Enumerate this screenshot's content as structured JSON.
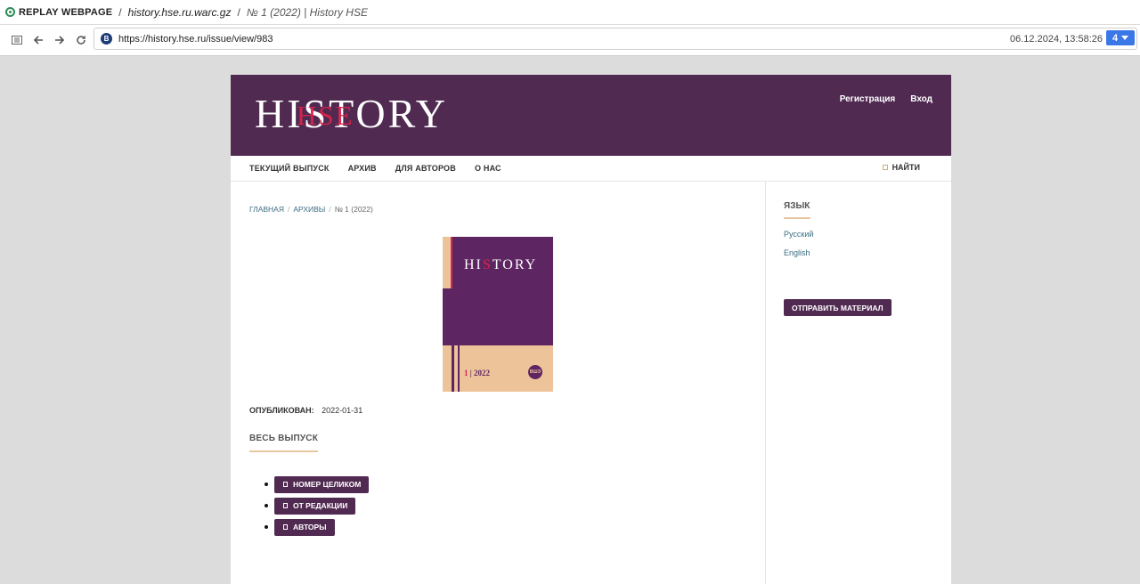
{
  "replay": {
    "brand": "REPLAY WEBPAGE",
    "archive": "history.hse.ru.warc.gz",
    "page_title": "№ 1 (2022) | History HSE"
  },
  "address_bar": {
    "url": "https://history.hse.ru/issue/view/983",
    "timestamp": "06.12.2024, 13:58:26",
    "capture_count": "4"
  },
  "header": {
    "logo_text": "HISTORY",
    "logo_overlay": "HSE",
    "user_nav": [
      "Регистрация",
      "Вход"
    ]
  },
  "main_nav": {
    "items": [
      "ТЕКУЩИЙ ВЫПУСК",
      "АРХИВ",
      "ДЛЯ АВТОРОВ",
      "О НАС"
    ],
    "search_label": "НАЙТИ"
  },
  "breadcrumbs": {
    "items": [
      "ГЛАВНАЯ",
      "АРХИВЫ",
      "№ 1 (2022)"
    ]
  },
  "cover": {
    "title_a": "HI",
    "title_s": "S",
    "title_b": "TORY",
    "issue_num": "1",
    "issue_year": "| 2022",
    "seal": "ВШЭ"
  },
  "issue": {
    "published_label": "ОПУБЛИКОВАН:",
    "published_date": "2022-01-31",
    "section_title": "ВЕСЬ ВЫПУСК",
    "galleys": [
      "НОМЕР ЦЕЛИКОМ",
      "ОТ РЕДАКЦИИ",
      "АВТОРЫ"
    ]
  },
  "sidebar": {
    "language_title": "ЯЗЫК",
    "languages": [
      "Русский",
      "English"
    ],
    "submit_label": "ОТПРАВИТЬ МАТЕРИАЛ"
  },
  "colors": {
    "brand_purple": "#512a52",
    "accent_red": "#d9244b",
    "peach": "#edc49a",
    "link": "#3b6e84"
  }
}
